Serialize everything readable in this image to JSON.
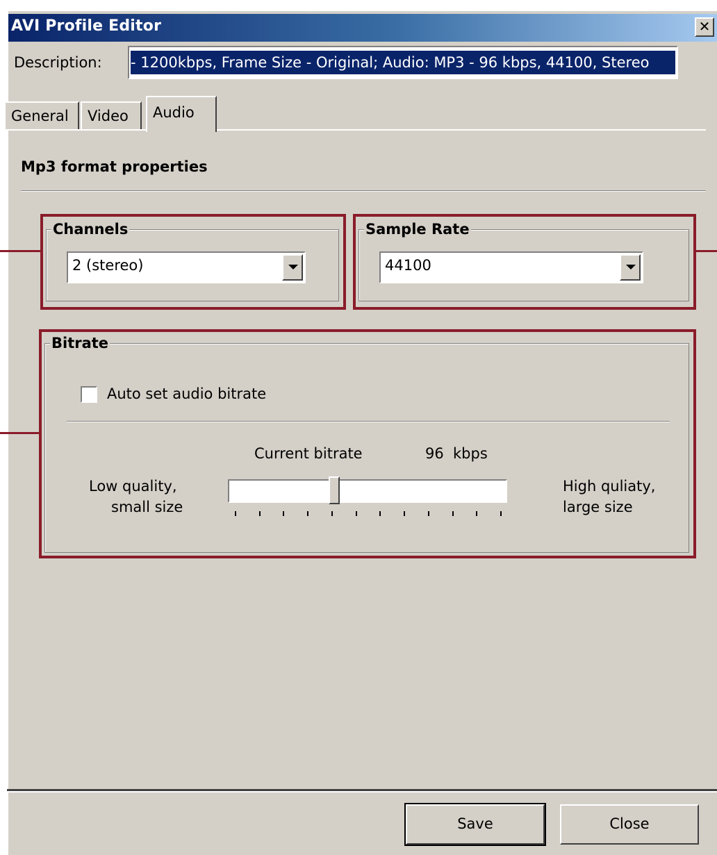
{
  "window": {
    "title": "AVI Profile Editor",
    "close_glyph": "✕"
  },
  "description": {
    "label": "Description:",
    "value": "- 1200kbps, Frame Size - Original; Audio: MP3 - 96 kbps, 44100, Stereo"
  },
  "tabs": [
    {
      "label": "General",
      "selected": false
    },
    {
      "label": "Video",
      "selected": false
    },
    {
      "label": "Audio",
      "selected": true
    }
  ],
  "audio": {
    "section_title": "Mp3 format properties",
    "channels": {
      "label": "Channels",
      "value": "2 (stereo)"
    },
    "sample_rate": {
      "label": "Sample Rate",
      "value": "44100"
    },
    "bitrate": {
      "label": "Bitrate",
      "auto_label": "Auto set audio bitrate",
      "auto_checked": false,
      "current_label": "Current bitrate",
      "current_value": "96",
      "unit": "kbps",
      "low_label_1": "Low quality,",
      "low_label_2": "small size",
      "high_label_1": "High quliaty,",
      "high_label_2": "large size",
      "slider_level": 0.375,
      "tick_count": 12
    }
  },
  "buttons": {
    "save": "Save",
    "close": "Close"
  },
  "colors": {
    "highlight_frame": "#8b1c2a",
    "title_gradient_start": "#0a246a",
    "dialog_face": "#d4d0c8"
  }
}
